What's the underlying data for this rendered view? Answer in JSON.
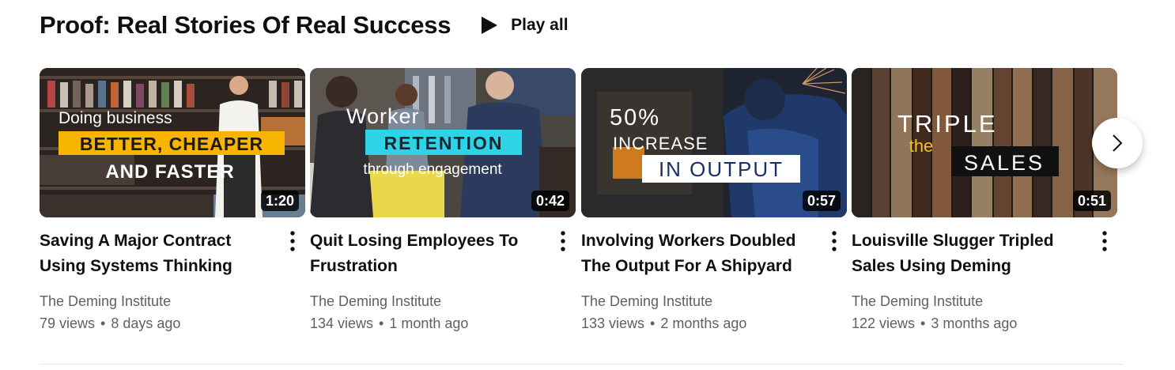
{
  "shelf": {
    "title": "Proof: Real Stories Of Real Success",
    "play_all_label": "Play all",
    "play_icon": "play-icon",
    "next_icon": "chevron-right-icon",
    "menu_icon": "more-vert-icon"
  },
  "videos": [
    {
      "title": "Saving A Major Contract Using Systems Thinking",
      "channel": "The Deming Institute",
      "views": "79 views",
      "age": "8 days ago",
      "duration": "1:20",
      "thumb_text": {
        "line1": "Doing business",
        "line2": "BETTER, CHEAPER",
        "line3": "AND FASTER"
      }
    },
    {
      "title": "Quit Losing Employees To Frustration",
      "channel": "The Deming Institute",
      "views": "134 views",
      "age": "1 month ago",
      "duration": "0:42",
      "thumb_text": {
        "line1": "Worker",
        "line2": "RETENTION",
        "line3": "through engagement"
      }
    },
    {
      "title": "Involving Workers Doubled The Output For A Shipyard",
      "channel": "The Deming Institute",
      "views": "133 views",
      "age": "2 months ago",
      "duration": "0:57",
      "thumb_text": {
        "line1": "50%",
        "line2": "INCREASE",
        "line3": "IN OUTPUT"
      }
    },
    {
      "title": "Louisville Slugger Tripled Sales Using Deming",
      "channel": "The Deming Institute",
      "views": "122 views",
      "age": "3 months ago",
      "duration": "0:51",
      "thumb_text": {
        "line1": "TRIPLE",
        "line2": "the",
        "line3": "SALES"
      }
    }
  ],
  "colors": {
    "text_primary": "#0f0f0f",
    "text_secondary": "#606060",
    "thumb1_banner": "#f7b500",
    "thumb2_banner": "#2ed3e6"
  }
}
